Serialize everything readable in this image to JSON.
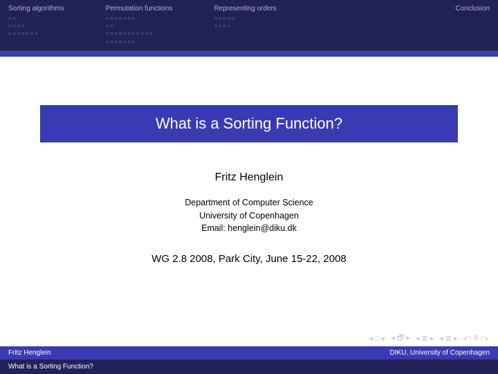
{
  "header": {
    "sections": [
      {
        "name": "Sorting algorithms",
        "dot_rows": [
          "○○",
          "○○○○",
          "○○○○○○○"
        ]
      },
      {
        "name": "Permutation functions",
        "dot_rows": [
          "○○○○○○○",
          "○○",
          "○○○○○○○○○○○",
          "○○○○○○○"
        ]
      },
      {
        "name": "Representing orders",
        "dot_rows": [
          "○○○○○",
          "○○○○"
        ]
      },
      {
        "name": "Conclusion",
        "dot_rows": []
      }
    ]
  },
  "title": "What is a Sorting Function?",
  "author": "Fritz Henglein",
  "affiliation": {
    "dept": "Department of Computer Science",
    "univ": "University of Copenhagen",
    "email": "Email: henglein@diku.dk"
  },
  "venue": "WG 2.8 2008, Park City, June 15-22, 2008",
  "nav": {
    "first": "◂ □ ▸",
    "prev": "◂ 🗗 ▸",
    "back": "◂ ≣ ▸",
    "fwd": "◂ ≣ ▸",
    "undo": "↶ ୭ ↷"
  },
  "footer1_left": "Fritz Henglein",
  "footer1_right": "DIKU, University of Copenhagen",
  "footer2": "What is a Sorting Function?"
}
